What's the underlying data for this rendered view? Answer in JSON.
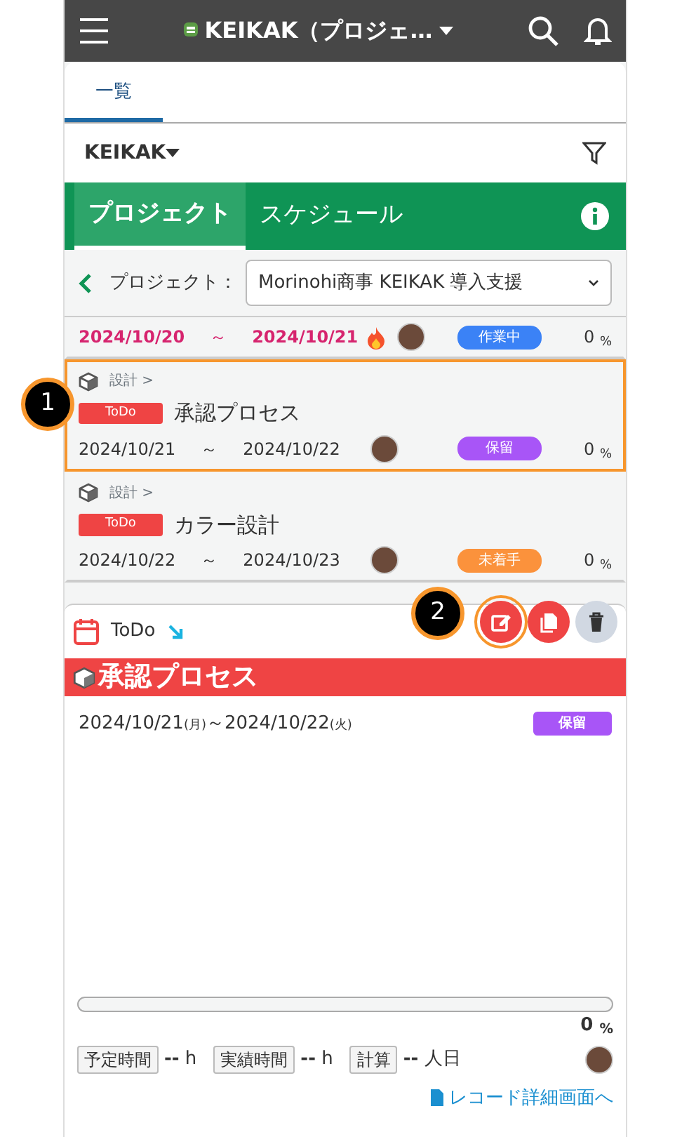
{
  "header": {
    "title": "KEIKAK（プロジェ…"
  },
  "tabs": [
    {
      "label": "一覧",
      "selected": true
    }
  ],
  "filter": {
    "label": "KEIKAK"
  },
  "mode_tabs": [
    {
      "label": "プロジェクト",
      "selected": true
    },
    {
      "label": "スケジュール",
      "selected": false
    }
  ],
  "project": {
    "label": "プロジェクト：",
    "value": "Morinohi商事 KEIKAK 導入支援"
  },
  "tasks": [
    {
      "start": "2024/10/20",
      "tilde": "～",
      "end": "2024/10/21",
      "overdue": true,
      "hot": true,
      "status": "作業中",
      "color": "#3b82f6",
      "progress": "0",
      "unit": "%",
      "selected": false
    },
    {
      "category": "設計",
      "sep": ">",
      "tag": "ToDo",
      "title": "承認プロセス",
      "start": "2024/10/21",
      "tilde": "～",
      "end": "2024/10/22",
      "overdue": false,
      "hot": false,
      "status": "保留",
      "color": "#a855f7",
      "progress": "0",
      "unit": "%",
      "selected": true
    },
    {
      "category": "設計",
      "sep": ">",
      "tag": "ToDo",
      "title": "カラー設計",
      "start": "2024/10/22",
      "tilde": "～",
      "end": "2024/10/23",
      "overdue": false,
      "hot": false,
      "status": "未着手",
      "color": "#fb923c",
      "progress": "0",
      "unit": "%",
      "selected": false
    }
  ],
  "detail": {
    "type": "ToDo",
    "title": "承認プロセス",
    "start": "2024/10/21",
    "start_day": "(月)",
    "tilde": "～",
    "end": "2024/10/22",
    "end_day": "(火)",
    "status": "保留",
    "color": "#a855f7",
    "level": 0,
    "progress": "0",
    "unit": "%",
    "metrics": [
      {
        "label": "予定時間",
        "value": "--",
        "unit": "h"
      },
      {
        "label": "実績時間",
        "value": "--",
        "unit": "h"
      },
      {
        "label": "計算",
        "value": "--",
        "unit": "人日"
      }
    ],
    "link": "レコード詳細画面へ",
    "actions": [
      {
        "kind": "edit",
        "highlighted": true
      },
      {
        "kind": "copy",
        "highlighted": false
      },
      {
        "kind": "delete",
        "highlighted": false
      }
    ]
  },
  "callouts": [
    {
      "number": "1"
    },
    {
      "number": "2"
    }
  ]
}
